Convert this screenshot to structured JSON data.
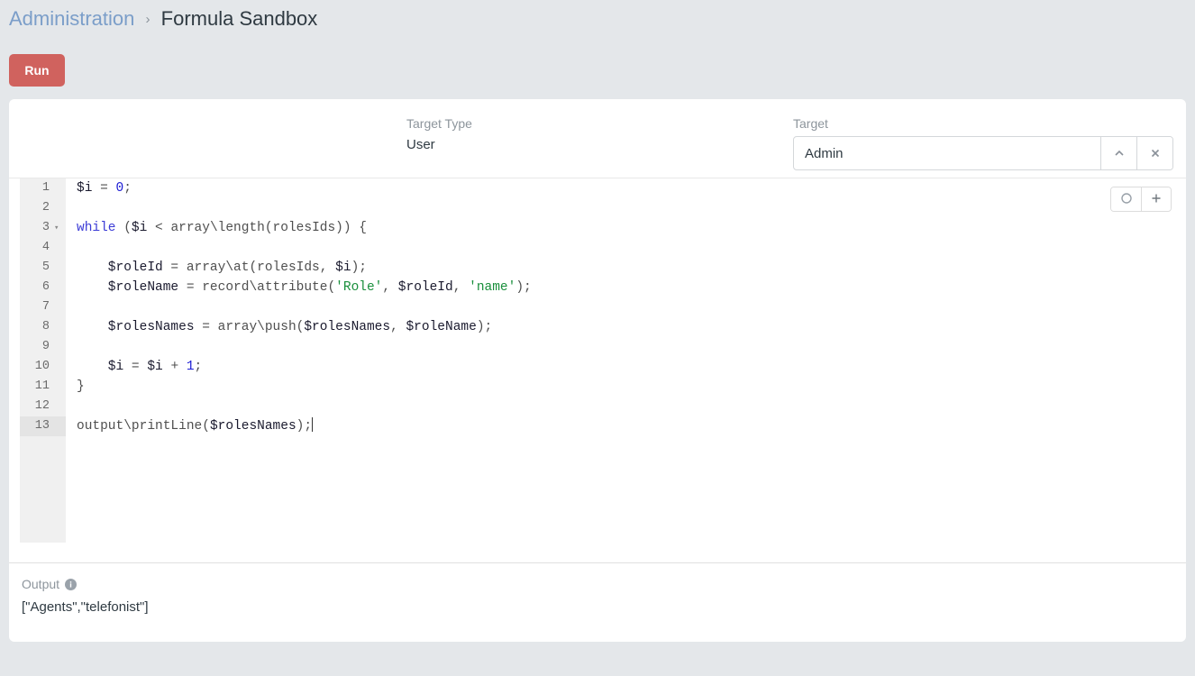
{
  "breadcrumb": {
    "parent": "Administration",
    "separator": "›",
    "current": "Formula Sandbox"
  },
  "toolbar": {
    "run_label": "Run"
  },
  "form": {
    "target_type": {
      "label": "Target Type",
      "value": "User"
    },
    "target": {
      "label": "Target",
      "value": "Admin",
      "placeholder": "",
      "up_icon": "chevron-up-icon",
      "clear_icon": "close-icon"
    }
  },
  "editor": {
    "tools": [
      {
        "icon": "circle-icon",
        "name": "circle-button"
      },
      {
        "icon": "plus-icon",
        "name": "add-button"
      }
    ],
    "active_line": 13,
    "lines": [
      {
        "num": "1",
        "fold": false,
        "tokens": [
          {
            "t": "$i ",
            "c": "tok-var"
          },
          {
            "t": "= ",
            "c": "tok-op"
          },
          {
            "t": "0",
            "c": "tok-num"
          },
          {
            "t": ";",
            "c": "tok-op"
          }
        ]
      },
      {
        "num": "2",
        "fold": false,
        "tokens": []
      },
      {
        "num": "3",
        "fold": true,
        "tokens": [
          {
            "t": "while",
            "c": "tok-kw"
          },
          {
            "t": " (",
            "c": "tok-op"
          },
          {
            "t": "$i ",
            "c": "tok-var"
          },
          {
            "t": "< ",
            "c": "tok-op"
          },
          {
            "t": "array\\length(rolesIds)) {",
            "c": "tok-op"
          }
        ]
      },
      {
        "num": "4",
        "fold": false,
        "tokens": []
      },
      {
        "num": "5",
        "fold": false,
        "tokens": [
          {
            "t": "    $roleId ",
            "c": "tok-var"
          },
          {
            "t": "= ",
            "c": "tok-op"
          },
          {
            "t": "array\\at(rolesIds, ",
            "c": "tok-op"
          },
          {
            "t": "$i",
            "c": "tok-var"
          },
          {
            "t": ");",
            "c": "tok-op"
          }
        ]
      },
      {
        "num": "6",
        "fold": false,
        "tokens": [
          {
            "t": "    $roleName ",
            "c": "tok-var"
          },
          {
            "t": "= ",
            "c": "tok-op"
          },
          {
            "t": "record\\attribute(",
            "c": "tok-op"
          },
          {
            "t": "'Role'",
            "c": "tok-str"
          },
          {
            "t": ", ",
            "c": "tok-op"
          },
          {
            "t": "$roleId",
            "c": "tok-var"
          },
          {
            "t": ", ",
            "c": "tok-op"
          },
          {
            "t": "'name'",
            "c": "tok-str"
          },
          {
            "t": ");",
            "c": "tok-op"
          }
        ]
      },
      {
        "num": "7",
        "fold": false,
        "tokens": []
      },
      {
        "num": "8",
        "fold": false,
        "tokens": [
          {
            "t": "    $rolesNames ",
            "c": "tok-var"
          },
          {
            "t": "= ",
            "c": "tok-op"
          },
          {
            "t": "array\\push(",
            "c": "tok-op"
          },
          {
            "t": "$rolesNames",
            "c": "tok-var"
          },
          {
            "t": ", ",
            "c": "tok-op"
          },
          {
            "t": "$roleName",
            "c": "tok-var"
          },
          {
            "t": ");",
            "c": "tok-op"
          }
        ]
      },
      {
        "num": "9",
        "fold": false,
        "tokens": []
      },
      {
        "num": "10",
        "fold": false,
        "tokens": [
          {
            "t": "    $i ",
            "c": "tok-var"
          },
          {
            "t": "= ",
            "c": "tok-op"
          },
          {
            "t": "$i ",
            "c": "tok-var"
          },
          {
            "t": "+ ",
            "c": "tok-op"
          },
          {
            "t": "1",
            "c": "tok-num"
          },
          {
            "t": ";",
            "c": "tok-op"
          }
        ]
      },
      {
        "num": "11",
        "fold": false,
        "tokens": [
          {
            "t": "}",
            "c": "tok-op"
          }
        ]
      },
      {
        "num": "12",
        "fold": false,
        "tokens": []
      },
      {
        "num": "13",
        "fold": false,
        "caret": true,
        "tokens": [
          {
            "t": "output\\printLine(",
            "c": "tok-op"
          },
          {
            "t": "$rolesNames",
            "c": "tok-var"
          },
          {
            "t": ");",
            "c": "tok-op"
          }
        ]
      }
    ]
  },
  "output": {
    "label": "Output",
    "info_icon": "info-icon",
    "value": "[\"Agents\",\"telefonist\"]"
  },
  "colors": {
    "page_background": "#e4e7ea",
    "panel_background": "#ffffff",
    "run_button": "#d0625e",
    "breadcrumb_link": "#7b9ec9",
    "label_text": "#8d959c",
    "body_text": "#2f3a42",
    "gutter": "#f0f0f0",
    "active_line": "#e4e4e4",
    "keyword": "#3b3bd6",
    "number": "#1c1cd4",
    "string": "#1a8f3c"
  }
}
